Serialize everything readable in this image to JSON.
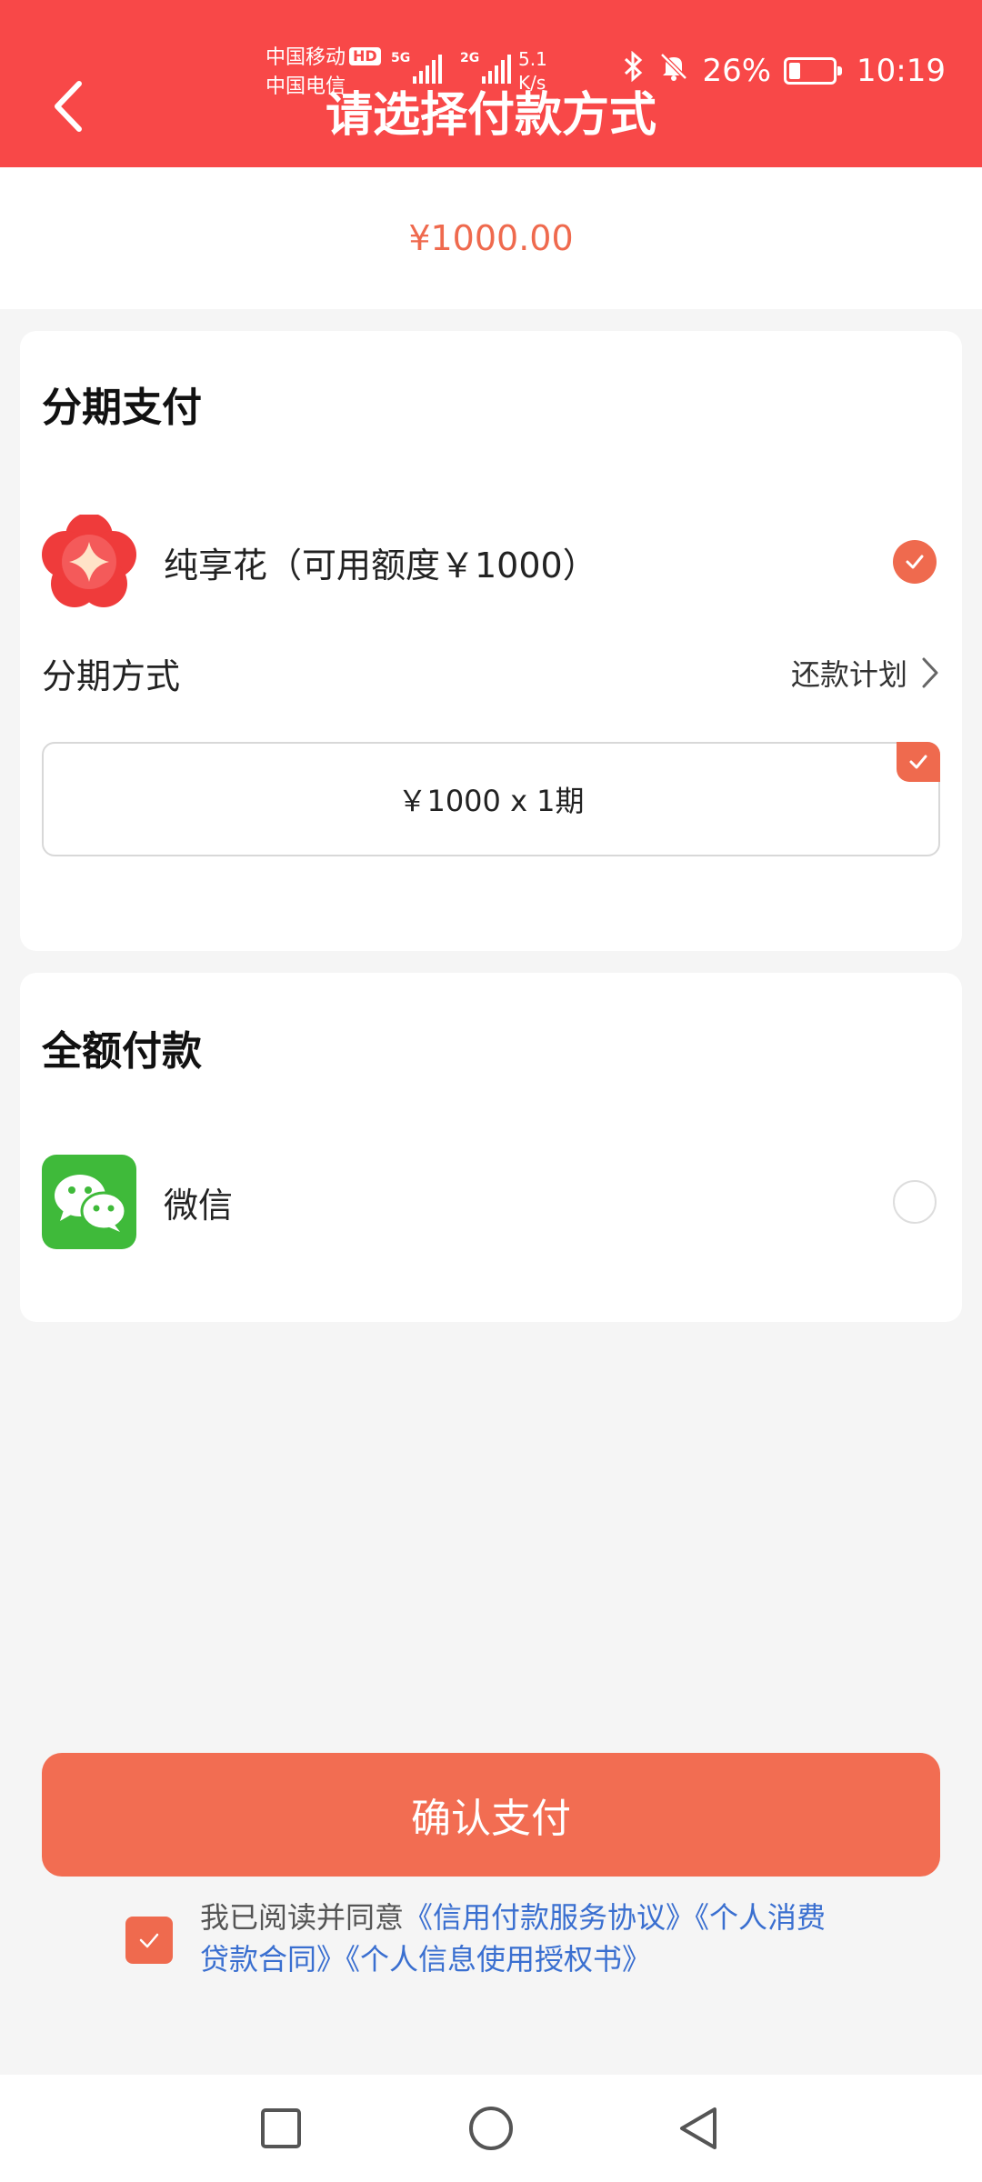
{
  "status_bar": {
    "carrier1": "中国移动",
    "hd": "HD",
    "carrier2": "中国电信",
    "net1": "5G",
    "net2": "2G",
    "speed_value": "5.1",
    "speed_unit": "K/s",
    "battery_text": "26%",
    "battery_level": 0.26,
    "time": "10:19"
  },
  "header": {
    "title": "请选择付款方式"
  },
  "amount": "¥1000.00",
  "installment": {
    "section_title": "分期支付",
    "provider_label": "纯享花（可用额度￥1000）",
    "provider_checked": true,
    "method_label": "分期方式",
    "plan_link": "还款计划",
    "option_text": "￥1000 x 1期",
    "option_selected": true
  },
  "full_payment": {
    "section_title": "全额付款",
    "wechat_label": "微信",
    "wechat_checked": false
  },
  "confirm_button": "确认支付",
  "agreement": {
    "checked": true,
    "prefix": "我已阅读并同意",
    "link1": "《信用付款服务协议》",
    "link2": "《个人消费贷款合同》",
    "link3": "《个人信息使用授权书》"
  },
  "colors": {
    "header": "#f84848",
    "accent": "#ef6a4e",
    "button": "#f26d52",
    "link": "#3a6fd0",
    "wechat": "#3fba3a"
  },
  "icons": {
    "back": "chevron-left-icon",
    "plan": "chevron-right-icon",
    "nav_recent": "square-icon",
    "nav_home": "circle-icon",
    "nav_back": "triangle-back-icon"
  }
}
